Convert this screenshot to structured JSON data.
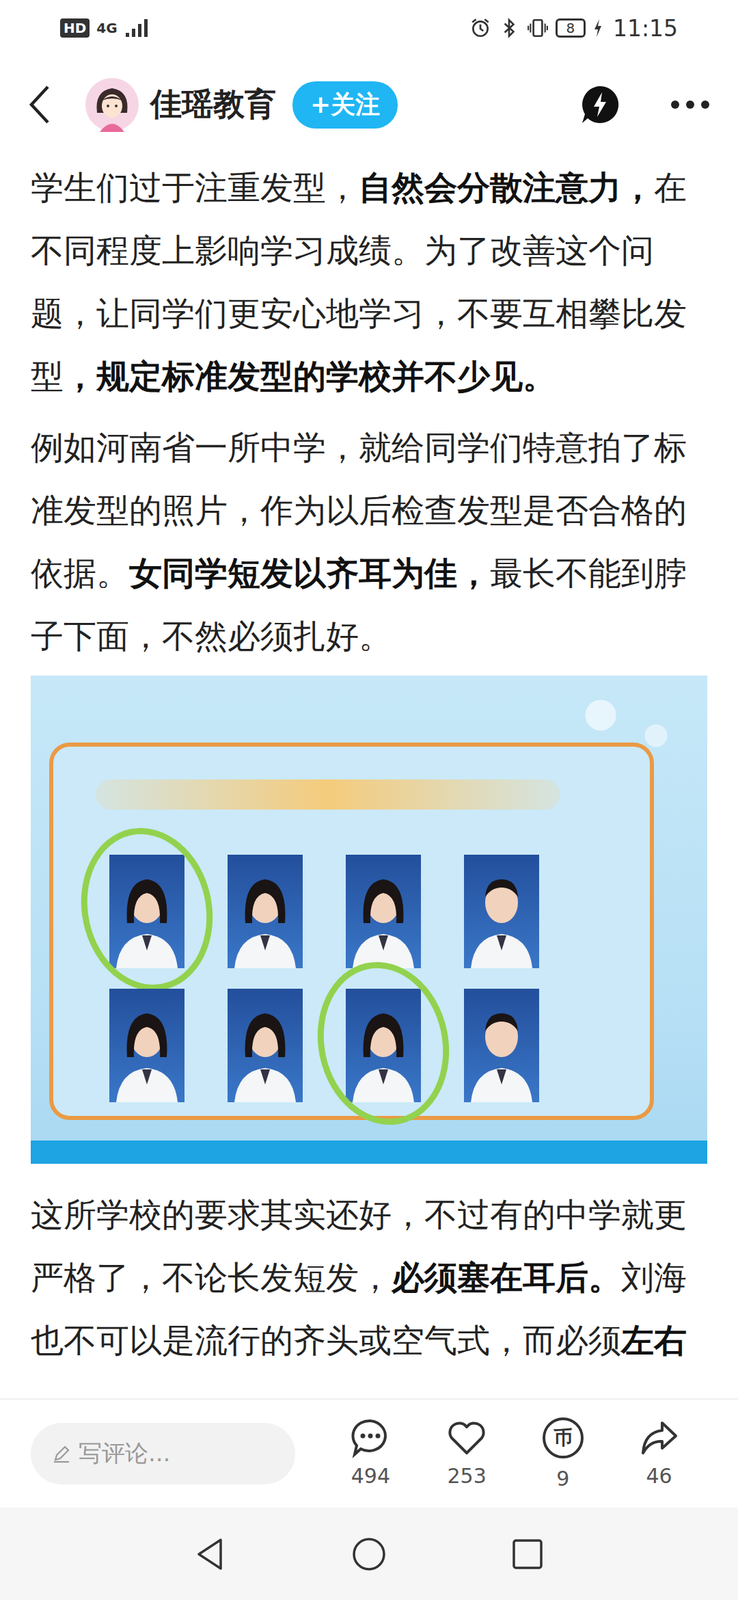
{
  "status_bar": {
    "hd": "HD",
    "network": "4G",
    "battery": "8",
    "time": "11:15"
  },
  "header": {
    "account": "佳瑶教育",
    "follow_button": "+关注"
  },
  "article": {
    "paragraphs_before": [
      {
        "segments": [
          {
            "text": "学生们过于注重发型，",
            "bold": false
          },
          {
            "text": "自然会分散注意力，",
            "bold": true
          },
          {
            "text": "在不同程度上影响学习成绩。为了改善这个问题，让同学们更安心地学习，不要互相攀比发型",
            "bold": false
          },
          {
            "text": "，规定标准发型的学校并不少见。",
            "bold": true
          }
        ]
      },
      {
        "segments": [
          {
            "text": "例如河南省一所中学，就给同学们特意拍了标准发型的照片，作为以后检查发型是否合格的依据。",
            "bold": false
          },
          {
            "text": "女同学短发以齐耳为佳，",
            "bold": true
          },
          {
            "text": "最长不能到脖子下面，不然必须扎好。",
            "bold": false
          }
        ]
      }
    ],
    "image": {
      "photos": [
        {
          "highlighted": true
        },
        {
          "highlighted": false
        },
        {
          "highlighted": false
        },
        {
          "highlighted": false
        },
        {
          "highlighted": false
        },
        {
          "highlighted": false
        },
        {
          "highlighted": true
        },
        {
          "highlighted": false
        }
      ]
    },
    "paragraphs_after": [
      {
        "segments": [
          {
            "text": "这所学校的要求其实还好，不过有的中学就更严格了，不论长发短发，",
            "bold": false
          },
          {
            "text": "必须塞在耳后。",
            "bold": true
          },
          {
            "text": "刘海也不可以是流行的齐头或空气式，而必须",
            "bold": false
          },
          {
            "text": "左右",
            "bold": true
          }
        ]
      }
    ]
  },
  "action_bar": {
    "comment_placeholder": "写评论...",
    "actions": [
      {
        "kind": "comment",
        "count": "494"
      },
      {
        "kind": "like",
        "count": "253"
      },
      {
        "kind": "coin",
        "glyph": "币",
        "count": "9"
      },
      {
        "kind": "share",
        "count": "46"
      }
    ]
  }
}
